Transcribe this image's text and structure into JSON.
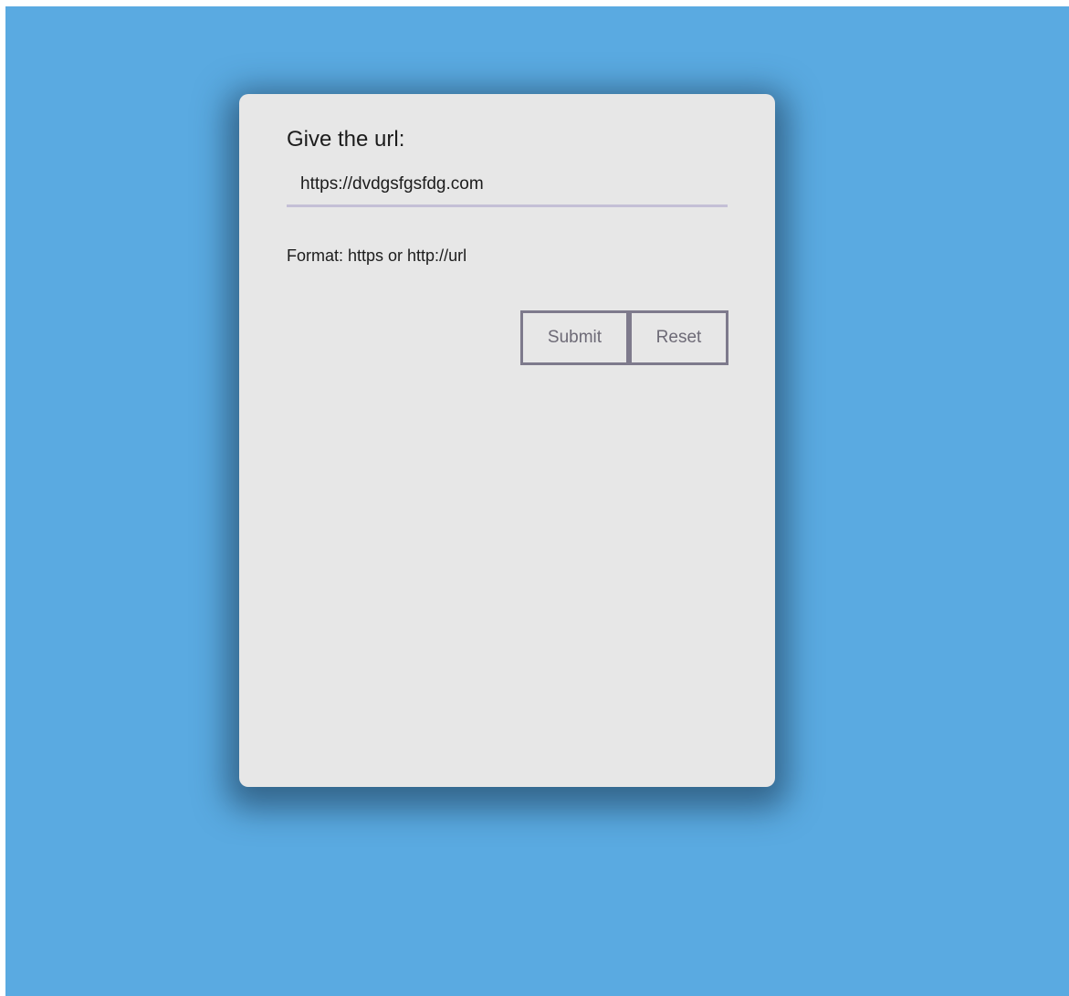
{
  "form": {
    "label": "Give the url:",
    "url_value": "https://dvdgsfgsfdg.com",
    "hint": "Format: https or http://url",
    "submit_label": "Submit",
    "reset_label": "Reset"
  },
  "colors": {
    "background": "#5aaae1",
    "card": "#e7e7e7",
    "input_underline": "#c4bfd6",
    "button_border": "#7e7a8c",
    "button_text": "#6d6a76"
  }
}
